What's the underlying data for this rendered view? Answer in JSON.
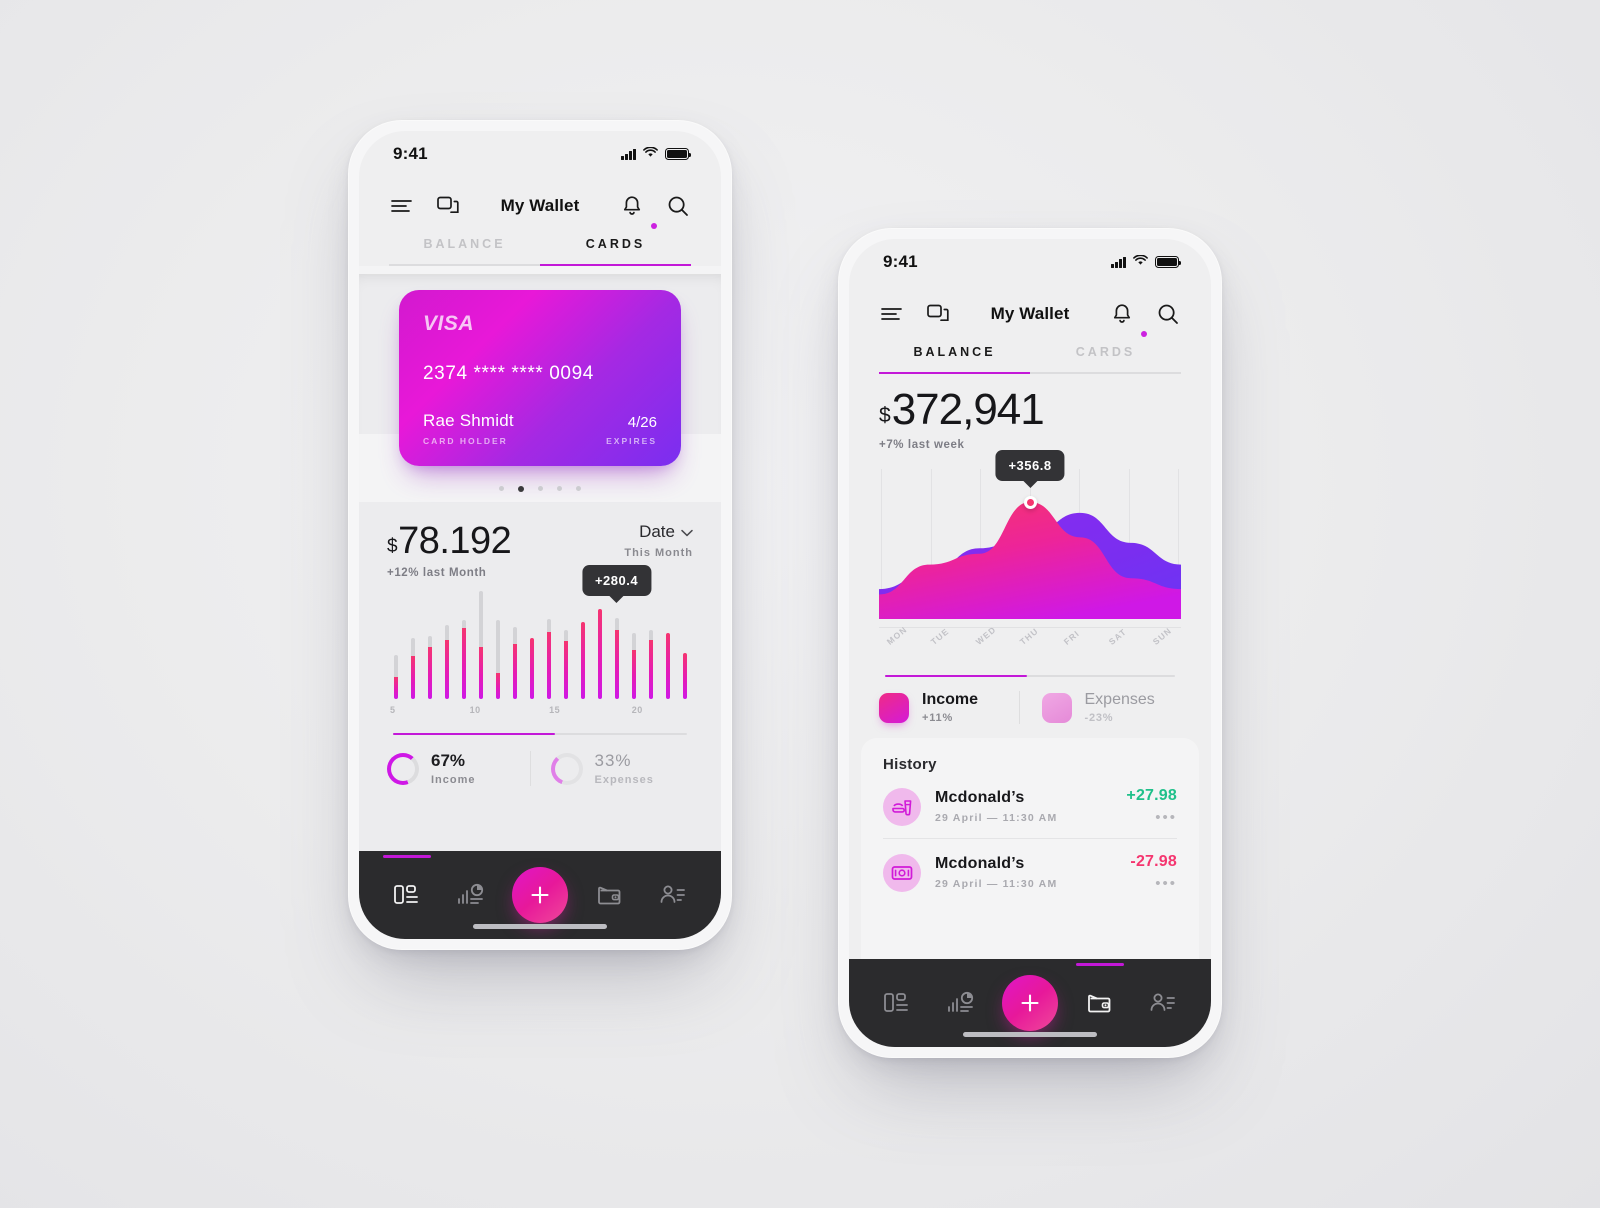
{
  "colors": {
    "accent": "#c318d8",
    "accent_pink": "#f5356f",
    "positive": "#1fc08a",
    "negative": "#f5356f",
    "nav_bg": "#2b2b2d"
  },
  "phone1": {
    "status": {
      "time": "9:41",
      "signal": "signal-bars",
      "wifi": "wifi",
      "battery": "battery-full"
    },
    "appbar": {
      "menu": "menu-icon",
      "chat": "chat-icon",
      "title": "My Wallet",
      "bell": "bell-icon",
      "search": "search-icon"
    },
    "tabs": [
      {
        "label": "BALANCE",
        "active": false
      },
      {
        "label": "CARDS",
        "active": true
      }
    ],
    "card": {
      "brand": "VISA",
      "number": "2374 **** **** 0094",
      "holder_name": "Rae Shmidt",
      "holder_caption": "CARD HOLDER",
      "expires_value": "4/26",
      "expires_caption": "EXPIRES"
    },
    "dots": {
      "count": 5,
      "active_index": 1
    },
    "summary": {
      "currency": "$",
      "amount": "78.192",
      "delta": "+12% last Month",
      "selector_label": "Date",
      "selector_caret": "chevron-down-icon",
      "selector_sub": "This Month"
    },
    "donuts": [
      {
        "value": "67%",
        "label": "Income",
        "percent": 67
      },
      {
        "value": "33%",
        "label": "Expenses",
        "percent": 33
      }
    ],
    "nav": [
      {
        "name": "dashboard",
        "active": true
      },
      {
        "name": "analytics",
        "active": false
      },
      {
        "name": "add",
        "active": false,
        "glyph": "+"
      },
      {
        "name": "wallet",
        "active": false
      },
      {
        "name": "profile",
        "active": false
      }
    ]
  },
  "phone2": {
    "status": {
      "time": "9:41",
      "signal": "signal-bars",
      "wifi": "wifi",
      "battery": "battery-full"
    },
    "appbar": {
      "menu": "menu-icon",
      "chat": "chat-icon",
      "title": "My Wallet",
      "bell": "bell-icon",
      "search": "search-icon"
    },
    "tabs": [
      {
        "label": "BALANCE",
        "active": true
      },
      {
        "label": "CARDS",
        "active": false
      }
    ],
    "summary": {
      "currency": "$",
      "amount": "372,941",
      "delta": "+7% last week"
    },
    "legend": [
      {
        "name": "Income",
        "sub": "+11%"
      },
      {
        "name": "Expenses",
        "sub": "-23%"
      }
    ],
    "history": {
      "title": "History",
      "rows": [
        {
          "icon": "fastfood-icon",
          "name": "Mcdonald’s",
          "meta": "29 April  —  11:30 AM",
          "amount": "+27.98",
          "sign": "pos",
          "menu": "•••"
        },
        {
          "icon": "cash-icon",
          "name": "Mcdonald’s",
          "meta": "29 April  —  11:30 AM",
          "amount": "-27.98",
          "sign": "neg",
          "menu": "•••"
        }
      ]
    },
    "nav": [
      {
        "name": "dashboard",
        "active": false
      },
      {
        "name": "analytics",
        "active": false
      },
      {
        "name": "add",
        "active": false,
        "glyph": "+"
      },
      {
        "name": "wallet",
        "active": true
      },
      {
        "name": "profile",
        "active": false
      }
    ]
  },
  "chart_data": [
    {
      "type": "bar",
      "title": "Daily spending this month",
      "tooltip": "+280.4",
      "tooltip_index": 13,
      "xlabel": "",
      "ylabel": "",
      "xticks": [
        5,
        10,
        15,
        20
      ],
      "xtick_positions_pct": [
        1,
        27,
        53,
        80
      ],
      "categories": [
        5,
        6,
        7,
        8,
        9,
        10,
        11,
        12,
        13,
        14,
        15,
        16,
        17,
        18,
        19,
        20,
        21,
        22
      ],
      "values": [
        22,
        44,
        53,
        60,
        72,
        53,
        27,
        56,
        62,
        68,
        59,
        78,
        92,
        70,
        50,
        60,
        67,
        47
      ],
      "cap_values": [
        45,
        62,
        64,
        75,
        80,
        110,
        80,
        73,
        62,
        82,
        70,
        78,
        92,
        83,
        67,
        70,
        67,
        47
      ],
      "ylim": [
        0,
        110
      ]
    },
    {
      "type": "area",
      "title": "Weekly balance",
      "tooltip": "+356.8",
      "tooltip_day": "THU",
      "xlabel": "",
      "ylabel": "",
      "categories": [
        "MON",
        "TUE",
        "WED",
        "THU",
        "FRI",
        "SAT",
        "SUN"
      ],
      "series": [
        {
          "name": "Expenses",
          "values": [
            22,
            34,
            52,
            62,
            78,
            56,
            40
          ],
          "color": "#7a2ef0"
        },
        {
          "name": "Income",
          "values": [
            18,
            40,
            48,
            86,
            60,
            30,
            22
          ],
          "color": "#e818d8"
        }
      ],
      "ylim": [
        0,
        100
      ],
      "grid": true,
      "legend_position": "below"
    }
  ]
}
